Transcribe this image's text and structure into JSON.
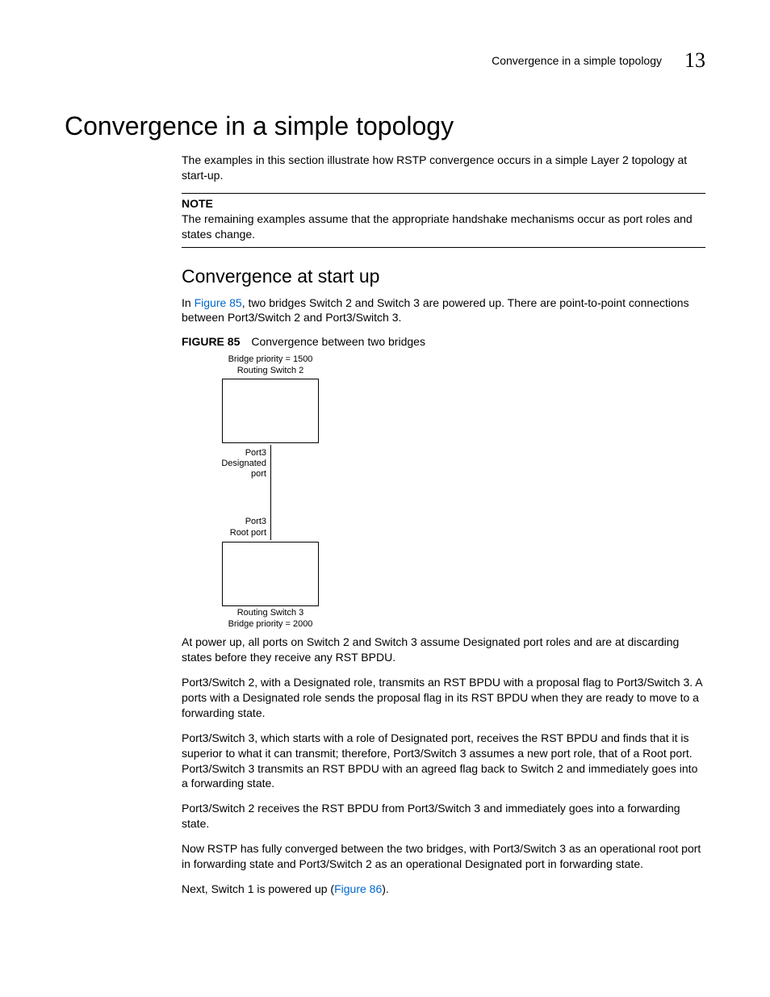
{
  "header": {
    "running_title": "Convergence in a simple topology",
    "chapter_number": "13"
  },
  "h1": "Convergence in a simple topology",
  "intro_para": "The examples in this section illustrate how RSTP convergence occurs in a simple Layer 2 topology at start-up.",
  "note": {
    "label": "NOTE",
    "text": "The remaining examples assume that the appropriate handshake mechanisms occur as port roles and states change."
  },
  "h2": "Convergence at start up",
  "para_before_fig_pre": "In ",
  "figure85_ref": "Figure 85",
  "para_before_fig_post": ", two bridges Switch 2 and Switch 3 are powered up. There are point-to-point connections between Port3/Switch 2 and Port3/Switch 3.",
  "figure85": {
    "label": "FIGURE 85",
    "caption": "Convergence between two bridges",
    "top_priority": "Bridge priority = 1500",
    "top_switch": "Routing Switch 2",
    "port_top_line1": "Port3",
    "port_top_line2": "Designated",
    "port_top_line3": "port",
    "port_bot_line1": "Port3",
    "port_bot_line2": "Root port",
    "bot_switch": "Routing Switch 3",
    "bot_priority": "Bridge priority = 2000"
  },
  "para_after_fig_1": "At power up, all ports on Switch 2 and Switch 3 assume Designated port roles and are at discarding states before they receive any RST BPDU.",
  "para_after_fig_2": "Port3/Switch 2, with a Designated role, transmits an RST BPDU with a proposal flag to Port3/Switch 3. A ports with a Designated role sends the proposal flag in its RST BPDU when they are ready to move to a forwarding state.",
  "para_after_fig_3": "Port3/Switch 3, which starts with a role of Designated port, receives the RST BPDU and finds that it is superior to what it can transmit; therefore, Port3/Switch 3 assumes a new port role, that of a Root port. Port3/Switch 3 transmits an RST BPDU with an agreed flag back to Switch 2 and immediately goes into a forwarding state.",
  "para_after_fig_4": "Port3/Switch 2 receives the RST BPDU from Port3/Switch 3 and immediately goes into a forwarding state.",
  "para_after_fig_5": "Now RSTP has fully converged between the two bridges, with Port3/Switch 3 as an operational root port in forwarding state and Port3/Switch 2 as an operational Designated port in forwarding state.",
  "para_last_pre": "Next, Switch 1 is powered up (",
  "figure86_ref": "Figure 86",
  "para_last_post": ")."
}
